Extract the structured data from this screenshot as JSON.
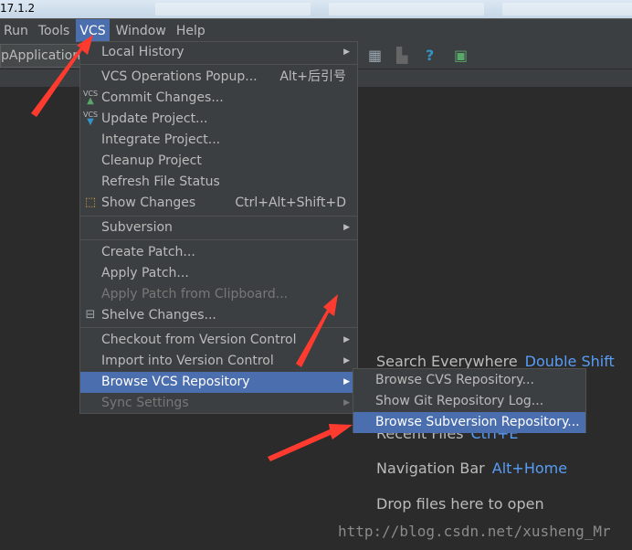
{
  "title_fragment": "17.1.2",
  "menubar": [
    "Run",
    "Tools",
    "VCS",
    "Window",
    "Help"
  ],
  "run_config": "pApplication",
  "vcs_menu": {
    "items": [
      {
        "label": "Local History",
        "submenu": true
      },
      {
        "label": "VCS Operations Popup...",
        "shortcut": "Alt+后引号"
      },
      {
        "label": "Commit Changes...",
        "icon": "vcs-commit-icon"
      },
      {
        "label": "Update Project...",
        "icon": "vcs-update-icon"
      },
      {
        "label": "Integrate Project..."
      },
      {
        "label": "Cleanup Project"
      },
      {
        "label": "Refresh File Status"
      },
      {
        "label": "Show Changes",
        "shortcut": "Ctrl+Alt+Shift+D",
        "icon": "show-changes-icon"
      },
      {
        "label": "Subversion",
        "submenu": true
      },
      {
        "label": "Create Patch..."
      },
      {
        "label": "Apply Patch..."
      },
      {
        "label": "Apply Patch from Clipboard...",
        "disabled": true
      },
      {
        "label": "Shelve Changes...",
        "icon": "shelve-icon"
      },
      {
        "label": "Checkout from Version Control",
        "submenu": true
      },
      {
        "label": "Import into Version Control",
        "submenu": true
      },
      {
        "label": "Browse VCS Repository",
        "submenu": true,
        "selected": true
      },
      {
        "label": "Sync Settings",
        "submenu": true,
        "disabled": true
      }
    ]
  },
  "browse_submenu": [
    "Browse CVS Repository...",
    "Show Git Repository Log...",
    "Browse Subversion Repository..."
  ],
  "welcome": [
    {
      "label": "Search Everywhere",
      "key": "Double Shift"
    },
    {
      "label": "Recent Files",
      "key": "Ctrl+E"
    },
    {
      "label": "Navigation Bar",
      "key": "Alt+Home"
    },
    {
      "label": "Drop files here to open",
      "key": ""
    }
  ],
  "watermark": "http://blog.csdn.net/xusheng_Mr",
  "colors": {
    "accent": "#4b6eaf",
    "background": "#2b2b2b",
    "menu": "#3c3f41",
    "link": "#589df6",
    "annotation": "#ff3b30"
  }
}
